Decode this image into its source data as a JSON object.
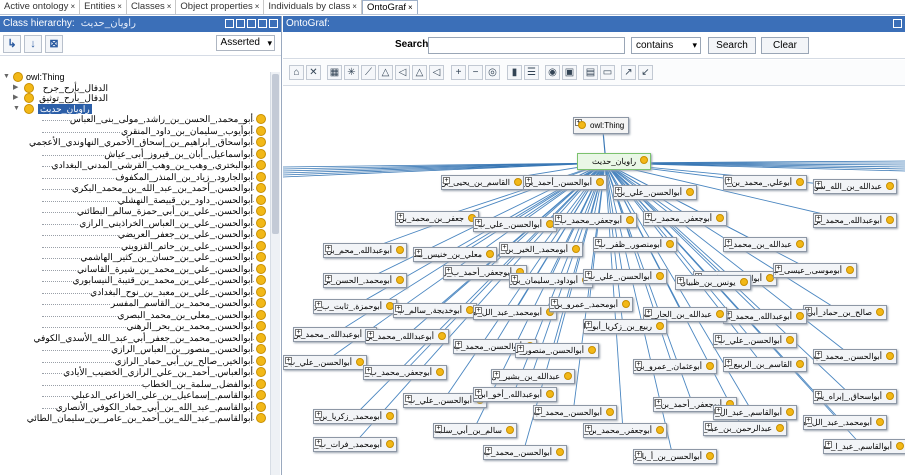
{
  "tabs": [
    {
      "label": "Active ontology",
      "active": false
    },
    {
      "label": "Entities",
      "active": false
    },
    {
      "label": "Classes",
      "active": false
    },
    {
      "label": "Object properties",
      "active": false
    },
    {
      "label": "Individuals by class",
      "active": false
    },
    {
      "label": "OntoGraf",
      "active": true
    }
  ],
  "tab_close": "×",
  "class_hierarchy": {
    "title": "Class hierarchy:",
    "selected_class": "راويان_حديث",
    "view_mode": "Asserted",
    "tree": [
      {
        "label": "owl:Thing",
        "expander": "▼"
      },
      {
        "label": "الدفال_بأرح_جرح",
        "expander": "▶"
      },
      {
        "label": "الدفال_بأرح_توثيق",
        "expander": "▶"
      },
      {
        "label": "راويان_حديث",
        "expander": "▼",
        "selected": true
      }
    ],
    "children": [
      "أبو_محمد,_الحسن_بن_راشد,_مولى_بنى_العباس",
      "أبوأيوب,_سليمان_بن_داود_المنقري",
      "أبواسحاق,_ابراهيم_بن_إسحاق_الأحمري_النهاوندي_الأعجمي",
      "أبواسماعيل,_أبان_بن_فيروز_أبى_عياش",
      "أبوالبختري,_وهب_بن_وهب_القرشي_المدني_البغدادي",
      "أبوالجارود,_زياد_بن_المنذر_المكفوف",
      "أبوالحسن,_أحمد_بن_عبد_الله_بن_محمد_البكري",
      "أبوالحسن,_داود_بن_قبيصة_النهشلي",
      "أبوالحسن,_علي_بن_أبي_حمزة_سالم_البطائني",
      "أبوالحسن,_علي_بن_العباس_الخراذيني_الرازي",
      "أبوالحسن,_علي_بن_جعفر_العريضي",
      "أبوالحسن,_علي_بن_حاتم_القزويني",
      "أبوالحسن,_علي_بن_حسان_بن_كثير_الهاشمي",
      "أبوالحسن,_علي_بن_محمد_بن_شيرة_القاساني",
      "أبوالحسن,_علي_بن_محمد_بن_قتيبة_النيسابوري",
      "أبوالحسن,_علي_بن_معبد_بن_نوح_البغدادي",
      "أبوالحسن,_محمد_بن_القاسم_المفسر",
      "أبوالحسن,_معلي_بن_محمد_البصري",
      "أبوالحسن,_محمد_بن_بحر_الرهني",
      "أبوالحسن,_محمد_بن_جعفر_أبي_عبد_الله_الأسدي_الكوفي",
      "أبوالحسن,_منصور_بن_العباس_الرازي",
      "أبوالخير,_صالح_بن_أبي_حماد_الرازي",
      "أبوالعباس,_أحمد_بن_علي_الرازي_الخضيب_الأيادي",
      "أبوالفضل,_سلمة_بن_الخطاب",
      "أبوالقاسم,_إسماعيل_بن_علي_الخزاعي_الدعبلي",
      "أبوالقاسم,_عبد_الله_بن_أبي_حماد_الكوفي_الأنصاري",
      "أبوالقاسم,_عبد_الله_بن_أحمد_بن_عامر_بن_سليمان_الطائي"
    ]
  },
  "ontograf": {
    "title": "OntoGraf:",
    "search_label": "Search:",
    "search_value": "",
    "match_mode": "contains",
    "search_button": "Search",
    "clear_button": "Clear",
    "root_node": "owl:Thing",
    "hub_node": "راويان_حديث",
    "nodes": [
      "القاسم_بن_يحيى_بن_الحسن_بن_راشد...",
      "أبوالحسن,_أحمد_بن_عبد_الله...",
      "أبوالحسن,_علي_بن_محمد_بن_نوح_ا...",
      "أبوعلي,_محمد_بن_الأش_..._القزان_بن_الأح...",
      "عبدالله_بن_الله_سوين_الحارث...",
      "جعفر_بن_محمد_بن_كوفي_العزاري",
      "أبوالحسن,_علي_ب_ن_أبي_محمد_العراق...",
      "أبوجعفر,_محمد_ب_ن_علي_الشلمغاني",
      "أبوجعفر,_محمد_ب_ن_علي_بن_إبراهي...",
      "أبوعبدالله,_محمد_بن_سليمان_الد...",
      "أبوعبدالله,_محم_بن_جعفر_جمهور_العم...",
      "معلي_بن_خنيس_مكي",
      "أبومنصور,_ظفر_ب_ن_حمدون_بن_شداد...",
      "أبومحمد,_الخير_بن_علي_الطا...",
      "عبدالله_بن_محمد_الشامي_الدمشق...",
      "أبومحمد,_الحسن_بن_راشد_الطفاوي...",
      "أبوجعفر,_أحمد_ب_ن_محمد_بن_خالد...",
      "أبوداود,_سليمان_بن_عمرو_النخعي",
      "أبوالحسن,_علي_ب_ن_أبي_حمزة_سالم...",
      "أبوالحسن,_علي_ب_ن_بن_موسى_بن_أبي_زاهر...",
      "أبوموسى,_عيسى_ب_ن_الستلة",
      "يونس_بن_ظبيان",
      "أبوحمزة,_ثابت_ب_ن_دينار_أبي_صفي...",
      "أبوخديجة,_سالم_ب_ن_مكرم_الجمال",
      "أبومحمد,_عبد_الل_ه_بن_محمد_بن...",
      "أبومحمد,_عمرو_بن_ثوبة_الصنعاني",
      "أبوعبدالله,_محمد_بن_أحمد_الحس...",
      "أبوعبدالله,_محمد_بن_عيسى_بن_عبيد...",
      "صالح_بن_حماد_أبي_جعفر_بن_الحفص...",
      "أبوعبدالله,_محمد_بن_الحسن_العمي...",
      "عبدالله_بن_الحار_ث_المخزومي",
      "ربيع_بن_زكريا_أبو_الوراق",
      "أبوالحسن,_علي_ب_ن_محمد_البرقي",
      "أبوالحسن,_محمد_ب_ن_إبراهيم...",
      "أبوالحسن,_منصور_ب_ن_العباس_الراز...",
      "أبوالحسن,_علي_ب_ن_جعفر_الزاهري",
      "القاسم_بن_الربيع_الصحاف",
      "أبوالحسن,_محمد_ب_ن_علي_الربعي",
      "أبوجعفر,_محمد_ب_ن_أحمد_بن_زيد",
      "عبدالله_بن_بشير_ال_دكلي",
      "أبوعثمان,_عمرو_بن_جميع_الأزدي...",
      "أبوالحسن,_علي_ب_ن_محمد_بن_قتيبة...",
      "أبوعبدالله,_أخو_ابن_عبيد...",
      "أبوجعفر,_أحمد_بن_أبي_عبد_الله...",
      "أبوالقاسم,_عبد_ال_له_بن_أحمد...",
      "أبواسحاق,_إبراه_يم_بن_إسحاق_الأ...",
      "أبومحمد,_زكريا_بن_محمد_المؤ...",
      "أبوالحسن,_محمد_ب_ن_جعفر_أبي_عب...",
      "سالم_بن_أبي_سلمة_الكندي",
      "أبوجعفر,_محمد_بن_موسى_بن_عيسى...",
      "أبومحمد,_فرات_ب_ن_الأحنف_العبدي...",
      "أبوالحسن,_محمد_ب_ن_سليمان...",
      "أبوالحسن_بن_أ_با_ن_الأشل",
      "عبدالرحمن_بن_عبد_ال...",
      "أبومحمد,_عبد_الل_ه_أحمد_بن_يحيى...",
      "أبوالقاسم,_عبد_ا_لله..."
    ]
  }
}
